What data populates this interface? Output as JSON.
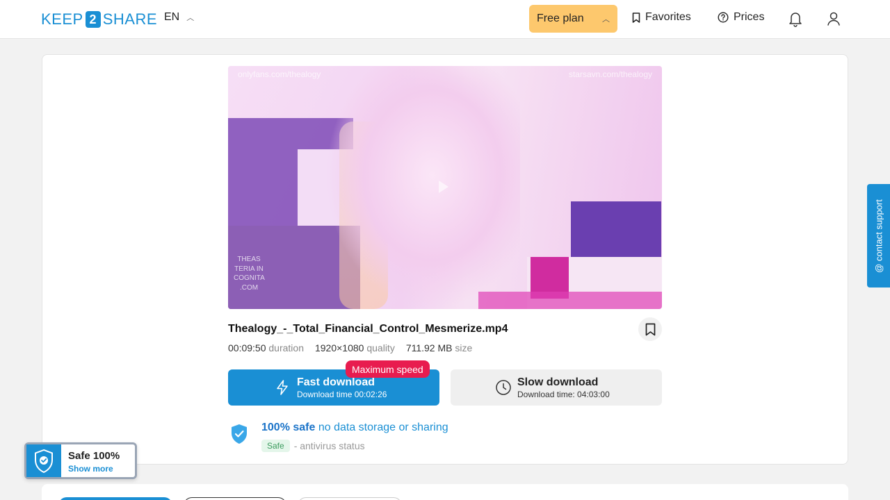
{
  "header": {
    "logo_left": "KEEP",
    "logo_mid": "2",
    "logo_right": "SHARE",
    "language": "EN",
    "plan_label": "Free plan",
    "favorites_label": "Favorites",
    "prices_label": "Prices"
  },
  "file": {
    "name": "Thealogy_-_Total_Financial_Control_Mesmerize.mp4",
    "duration": "00:09:50",
    "duration_label": "duration",
    "quality": "1920×1080",
    "quality_label": "quality",
    "size": "711.92 MB",
    "size_label": "size",
    "watermark_left": "onlyfans.com/thealogy",
    "watermark_right": "starsavn.com/thealogy",
    "watermark_side": "THEAS TERIA IN COGNITA .COM"
  },
  "download": {
    "badge": "Maximum speed",
    "fast_label": "Fast download",
    "fast_time": "Download time 00:02:26",
    "slow_label": "Slow download",
    "slow_time": "Download time: 04:03:00"
  },
  "safety": {
    "headline_strong": "100% safe",
    "headline_rest": "no data storage or sharing",
    "status_tag": "Safe",
    "status_text": "- antivirus status"
  },
  "support_label": "@ contact support",
  "widget": {
    "title": "Safe 100%",
    "link": "Show more"
  },
  "colors": {
    "brand": "#1a8fd4",
    "plan": "#fdc86d",
    "badge": "#e81c4f"
  }
}
